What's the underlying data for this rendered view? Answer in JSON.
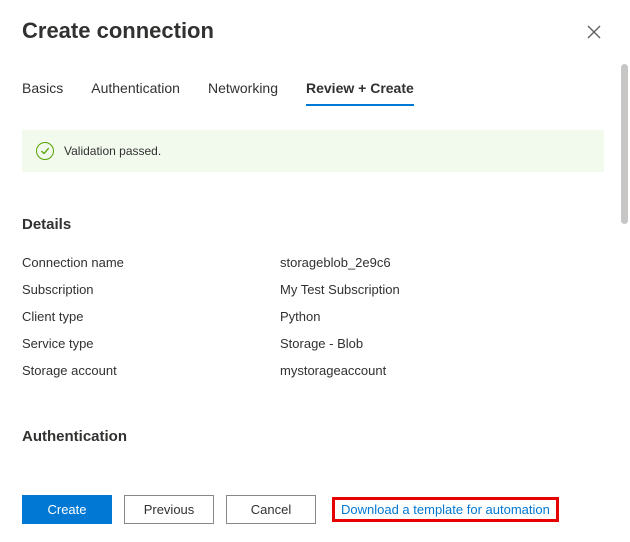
{
  "header": {
    "title": "Create connection"
  },
  "tabs": {
    "basics": "Basics",
    "authentication": "Authentication",
    "networking": "Networking",
    "review": "Review + Create"
  },
  "validation": {
    "message": "Validation passed."
  },
  "sections": {
    "details_title": "Details",
    "auth_title": "Authentication"
  },
  "details": {
    "connection_name_label": "Connection name",
    "connection_name_value": "storageblob_2e9c6",
    "subscription_label": "Subscription",
    "subscription_value": "My Test Subscription",
    "client_type_label": "Client type",
    "client_type_value": "Python",
    "service_type_label": "Service type",
    "service_type_value": "Storage - Blob",
    "storage_account_label": "Storage account",
    "storage_account_value": "mystorageaccount"
  },
  "footer": {
    "create": "Create",
    "previous": "Previous",
    "cancel": "Cancel",
    "download_template": "Download a template for automation"
  }
}
